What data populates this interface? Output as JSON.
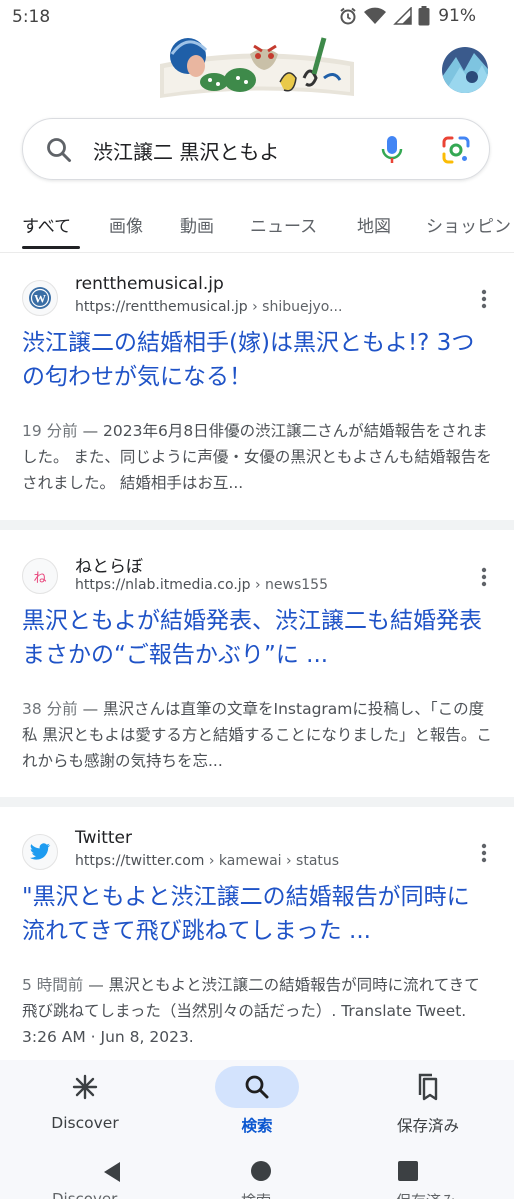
{
  "status_bar": {
    "time": "5:18",
    "battery": "91%"
  },
  "search": {
    "query": "渋江譲二 黒沢ともよ"
  },
  "tabs": [
    {
      "label": "すべて"
    },
    {
      "label": "画像"
    },
    {
      "label": "動画"
    },
    {
      "label": "ニュース"
    },
    {
      "label": "地図"
    },
    {
      "label": "ショッピン"
    }
  ],
  "results": [
    {
      "site_name": "rentthemusical.jp",
      "url": "https://rentthemusical.jp",
      "url_path": " › shibuejyo...",
      "title": "渋江譲二の結婚相手(嫁)は黒沢ともよ!? 3つの匂わせが気になる！",
      "time": "19 分前",
      "snippet": "2023年6月8日俳優の渋江譲二さんが結婚報告をされました。 また、同じように声優・女優の黒沢ともよさんも結婚報告をされました。 結婚相手はお互...",
      "icon": "wordpress-icon"
    },
    {
      "site_name": "ねとらぼ",
      "url": "https://nlab.itmedia.co.jp",
      "url_path": " › news155",
      "title": "黒沢ともよが結婚発表、渋江譲二も結婚発表 まさかの“ご報告かぶり”に ...",
      "time": "38 分前",
      "snippet": "黒沢さんは直筆の文章をInstagramに投稿し、「この度 私 黒沢ともよは愛する方と結婚することになりました」と報告。これからも感謝の気持ちを忘...",
      "icon": "netorabo-icon",
      "icon_text": "ね"
    },
    {
      "site_name": "Twitter",
      "url": "https://twitter.com",
      "url_path": " › kamewai › status",
      "title": "\"黒沢ともよと渋江譲二の結婚報告が同時に流れてきて飛び跳ねてしまった ...",
      "time": "5 時間前",
      "snippet": "黒沢ともよと渋江譲二の結婚報告が同時に流れてきて飛び跳ねてしまった（当然別々の話だった）. Translate Tweet. 3:26 AM · Jun 8, 2023.",
      "icon": "twitter-icon"
    }
  ],
  "bottom_nav": [
    {
      "label": "Discover",
      "icon": "asterisk-icon"
    },
    {
      "label": "検索",
      "icon": "search-icon",
      "active": true
    },
    {
      "label": "保存済み",
      "icon": "bookmarks-icon"
    }
  ],
  "colors": {
    "link": "#1f53c7",
    "active_nav": "#d3e3fd",
    "active_text": "#0b57d0"
  }
}
